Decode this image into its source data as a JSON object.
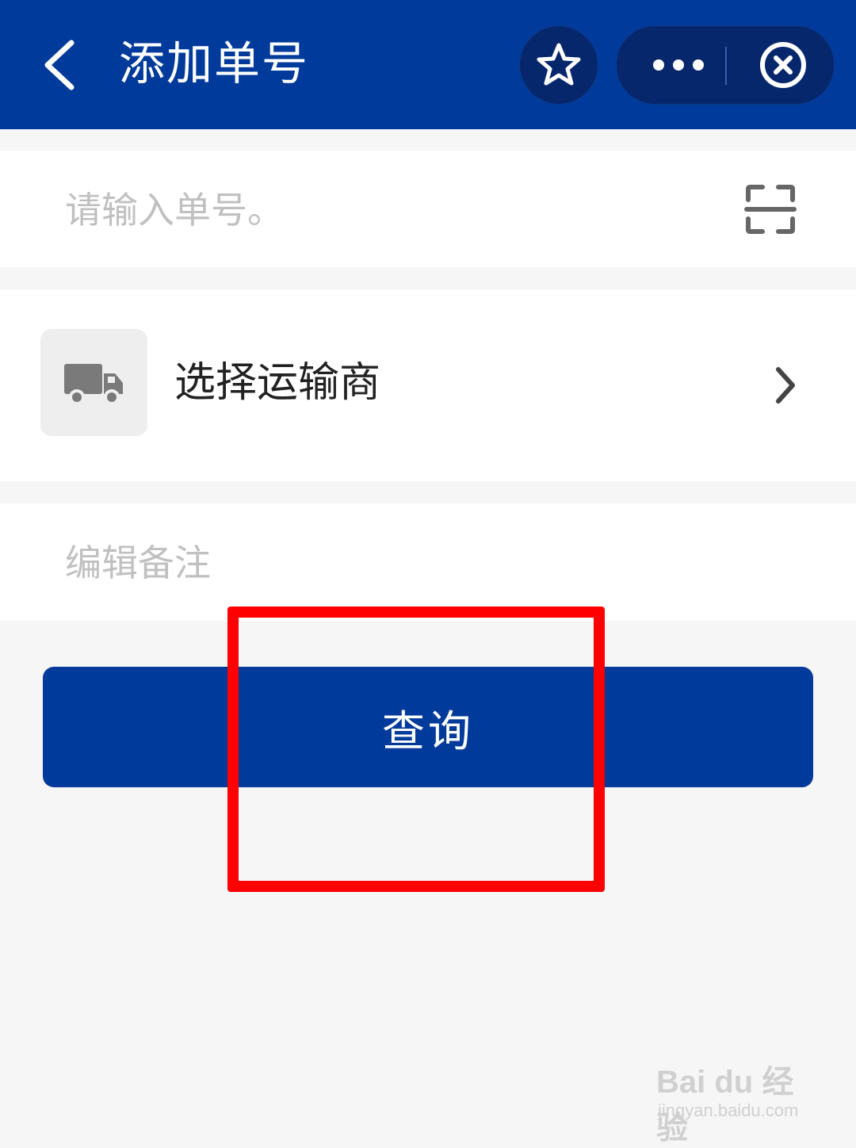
{
  "header": {
    "title": "添加单号",
    "back_icon": "chevron-left-icon",
    "favorite_icon": "star-icon",
    "more_icon": "more-dots-icon",
    "close_icon": "close-circle-icon",
    "background_color": "#003a9a"
  },
  "tracking_input": {
    "placeholder": "请输入单号。",
    "value": "",
    "scan_icon": "scan-icon"
  },
  "carrier": {
    "label": "选择运输商",
    "icon": "truck-icon",
    "arrow_icon": "chevron-right-icon"
  },
  "remark": {
    "placeholder": "编辑备注",
    "value": ""
  },
  "query_button": {
    "label": "查询",
    "color": "#003a9a"
  },
  "annotation": {
    "highlight_color": "#ff0000"
  },
  "watermark": {
    "brand": "Bai du 经验",
    "url": "jingyan.baidu.com"
  }
}
